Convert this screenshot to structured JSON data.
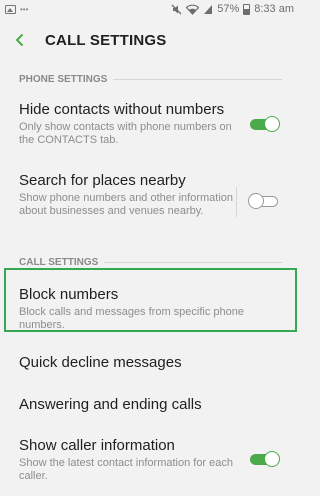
{
  "status": {
    "time": "8:33 am",
    "battery": "57%",
    "icons": [
      "gallery-icon",
      "more-dots-icon",
      "mute-icon",
      "wifi-icon",
      "signal-icon",
      "battery-icon"
    ]
  },
  "header": {
    "title": "CALL SETTINGS",
    "back_icon": "back-arrow-icon",
    "accent_color": "#4bab4b"
  },
  "sections": {
    "phone": "PHONE SETTINGS",
    "call": "CALL SETTINGS"
  },
  "items": {
    "hide_contacts": {
      "title": "Hide contacts without numbers",
      "subtitle": "Only show contacts with phone numbers on the CONTACTS tab.",
      "toggle_on": true
    },
    "search_places": {
      "title": "Search for places nearby",
      "subtitle": "Show phone numbers and other information about businesses and venues nearby.",
      "toggle_on": false
    },
    "block_numbers": {
      "title": "Block numbers",
      "subtitle": "Block calls and messages from specific phone numbers."
    },
    "quick_decline": {
      "title": "Quick decline messages"
    },
    "answering": {
      "title": "Answering and ending calls"
    },
    "caller_info": {
      "title": "Show caller information",
      "subtitle": "Show the latest contact information for each caller.",
      "toggle_on": true
    }
  },
  "highlight_color": "#34a853"
}
